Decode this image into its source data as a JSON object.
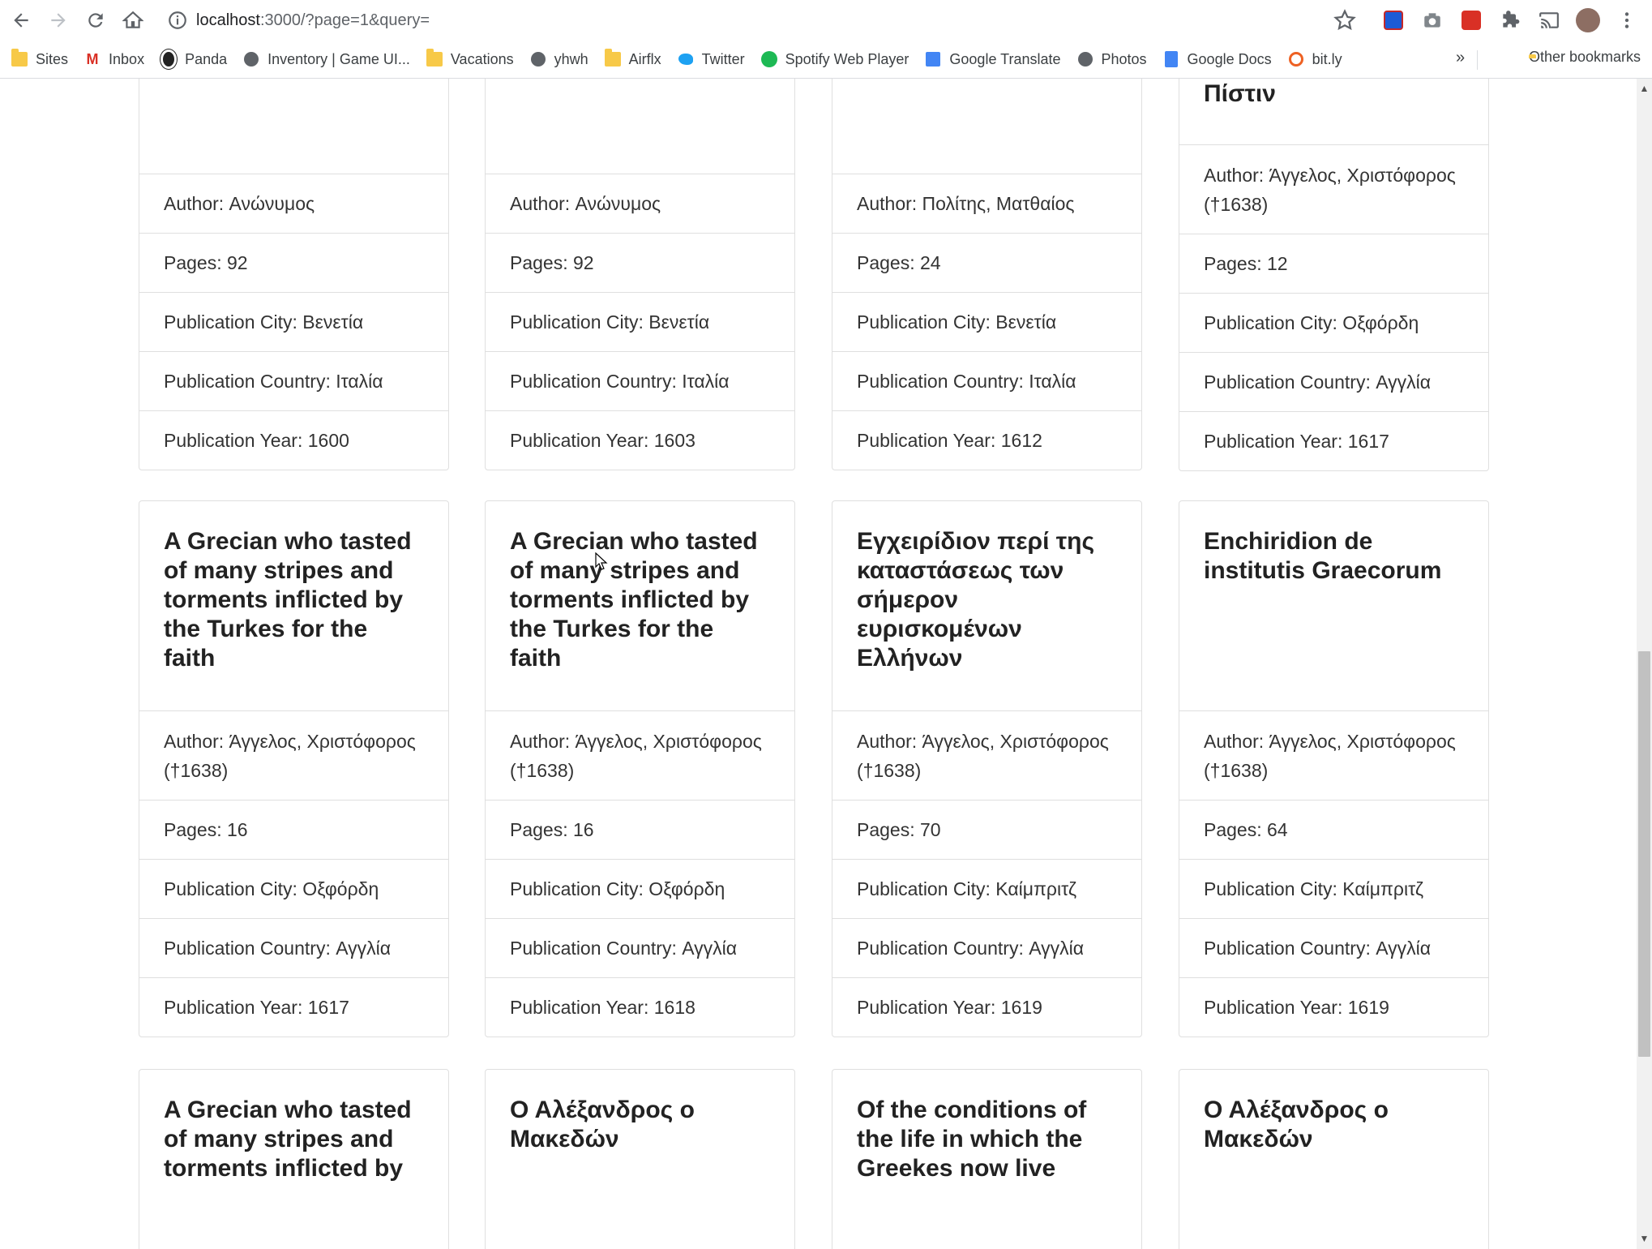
{
  "browser": {
    "url_host": "localhost",
    "url_rest": ":3000/?page=1&query=",
    "bookmarks": [
      {
        "label": "Sites",
        "icon": "folder-icon"
      },
      {
        "label": "Inbox",
        "icon": "gmail-icon"
      },
      {
        "label": "Panda",
        "icon": "panda-icon"
      },
      {
        "label": "Inventory | Game UI...",
        "icon": "globe-icon"
      },
      {
        "label": "Vacations",
        "icon": "folder-icon"
      },
      {
        "label": "yhwh",
        "icon": "globe-icon"
      },
      {
        "label": "Airflx",
        "icon": "folder-icon"
      },
      {
        "label": "Twitter",
        "icon": "twitter-icon"
      },
      {
        "label": "Spotify Web Player",
        "icon": "spotify-icon"
      },
      {
        "label": "Google Translate",
        "icon": "translate-icon"
      },
      {
        "label": "Photos",
        "icon": "globe-icon"
      },
      {
        "label": "Google Docs",
        "icon": "docs-icon"
      },
      {
        "label": "bit.ly",
        "icon": "bitly-icon"
      }
    ],
    "overflow": "»",
    "other_bookmarks": "Other bookmarks"
  },
  "books": [
    {
      "title": "",
      "author": "Author: Ανώνυμος",
      "pages": "Pages: 92",
      "city": "Publication City: Βενετία",
      "country": "Publication Country: Ιταλία",
      "year": "Publication Year: 1600"
    },
    {
      "title": "",
      "author": "Author: Ανώνυμος",
      "pages": "Pages: 92",
      "city": "Publication City: Βενετία",
      "country": "Publication Country: Ιταλία",
      "year": "Publication Year: 1603"
    },
    {
      "title": "",
      "author": "Author: Πολίτης, Ματθαίος",
      "pages": "Pages: 24",
      "city": "Publication City: Βενετία",
      "country": "Publication Country: Ιταλία",
      "year": "Publication Year: 1612"
    },
    {
      "title": "παρά των Τούρκων διά την εις Χριστόν Πίστιν",
      "author": "Author: Άγγελος, Χριστόφορος (†1638)",
      "pages": "Pages: 12",
      "city": "Publication City: Οξφόρδη",
      "country": "Publication Country: Αγγλία",
      "year": "Publication Year: 1617"
    },
    {
      "title": "A Grecian who tasted of many stripes and torments inflicted by the Turkes for the faith",
      "author": "Author: Άγγελος, Χριστόφορος (†1638)",
      "pages": "Pages: 16",
      "city": "Publication City: Οξφόρδη",
      "country": "Publication Country: Αγγλία",
      "year": "Publication Year: 1617"
    },
    {
      "title": "A Grecian who tasted of many stripes and torments inflicted by the Turkes for the faith",
      "author": "Author: Άγγελος, Χριστόφορος (†1638)",
      "pages": "Pages: 16",
      "city": "Publication City: Οξφόρδη",
      "country": "Publication Country: Αγγλία",
      "year": "Publication Year: 1618"
    },
    {
      "title": "Εγχειρίδιον περί της καταστάσεως των σήμερον ευρισκομένων Ελλήνων",
      "author": "Author: Άγγελος, Χριστόφορος (†1638)",
      "pages": "Pages: 70",
      "city": "Publication City: Καίμπριτζ",
      "country": "Publication Country: Αγγλία",
      "year": "Publication Year: 1619"
    },
    {
      "title": "Enchiridion de institutis Graecorum",
      "author": "Author: Άγγελος, Χριστόφορος (†1638)",
      "pages": "Pages: 64",
      "city": "Publication City: Καίμπριτζ",
      "country": "Publication Country: Αγγλία",
      "year": "Publication Year: 1619"
    },
    {
      "title": "A Grecian who tasted of many stripes and torments inflicted by"
    },
    {
      "title": "Ο Αλέξανδρος ο Μακεδών"
    },
    {
      "title": "Of the conditions of the life in which the Greekes now live"
    },
    {
      "title": "Ο Αλέξανδρος ο Μακεδών"
    }
  ]
}
